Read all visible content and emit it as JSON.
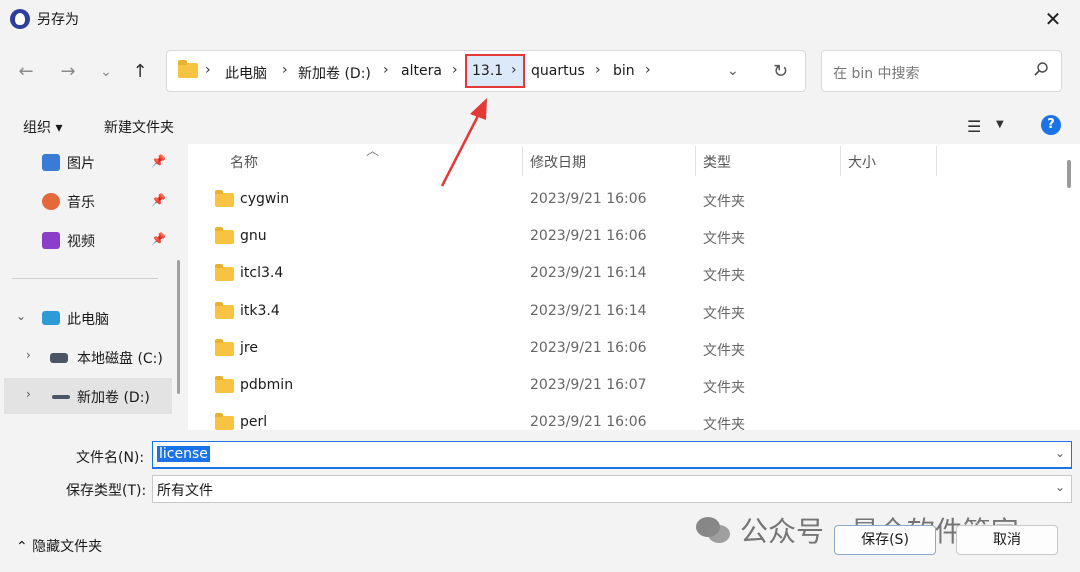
{
  "window": {
    "title": "另存为",
    "close": "✕"
  },
  "nav": {
    "back": "←",
    "forward": "→",
    "recent": "⌄",
    "up": "↑"
  },
  "breadcrumb": [
    {
      "label": "此电脑"
    },
    {
      "label": "新加卷 (D:)"
    },
    {
      "label": "altera"
    },
    {
      "label": "13.1"
    },
    {
      "label": "quartus"
    },
    {
      "label": "bin"
    }
  ],
  "breadcrumb_sep": "›",
  "address": {
    "dropdown": "⌄",
    "refresh": "↻"
  },
  "search": {
    "placeholder": "在 bin 中搜索"
  },
  "toolbar": {
    "organize": "组织 ▾",
    "new_folder": "新建文件夹",
    "view": "☰",
    "view_dd": "▼",
    "help": "?"
  },
  "sidebar": {
    "items": [
      {
        "label": "图片",
        "pin": "📌"
      },
      {
        "label": "音乐",
        "pin": "📌"
      },
      {
        "label": "视频",
        "pin": "📌"
      },
      {
        "label": "此电脑"
      },
      {
        "label": "本地磁盘 (C:)"
      },
      {
        "label": "新加卷 (D:)"
      }
    ],
    "expand_open": "⌄",
    "expand_closed": "›"
  },
  "columns": {
    "name": "名称",
    "modified": "修改日期",
    "type": "类型",
    "size": "大小",
    "sort": "︿"
  },
  "files": [
    {
      "name": "cygwin",
      "modified": "2023/9/21 16:06",
      "type": "文件夹"
    },
    {
      "name": "gnu",
      "modified": "2023/9/21 16:06",
      "type": "文件夹"
    },
    {
      "name": "itcl3.4",
      "modified": "2023/9/21 16:14",
      "type": "文件夹"
    },
    {
      "name": "itk3.4",
      "modified": "2023/9/21 16:14",
      "type": "文件夹"
    },
    {
      "name": "jre",
      "modified": "2023/9/21 16:06",
      "type": "文件夹"
    },
    {
      "name": "pdbmin",
      "modified": "2023/9/21 16:07",
      "type": "文件夹"
    },
    {
      "name": "perl",
      "modified": "2023/9/21 16:06",
      "type": "文件夹"
    }
  ],
  "save": {
    "filename_label": "文件名(N):",
    "filename_value": "license",
    "filetype_label": "保存类型(T):",
    "filetype_value": "所有文件",
    "dropdown": "⌄",
    "hide_folders": "⌃ 隐藏文件夹",
    "save_button": "保存(S)",
    "cancel_button": "取消"
  },
  "watermark": "公众号 · 最全软件管家",
  "colors": {
    "highlight_box": "#e53935",
    "accent": "#1a73e8",
    "folder": "#f6c343"
  }
}
